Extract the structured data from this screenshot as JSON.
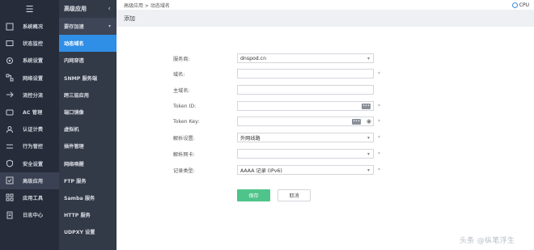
{
  "sidebar": {
    "menu_icon": "☰",
    "items": [
      {
        "label": "系统概况",
        "icon": "dashboard-icon"
      },
      {
        "label": "状态监控",
        "icon": "monitor-icon"
      },
      {
        "label": "系统设置",
        "icon": "gear-icon"
      },
      {
        "label": "网络设置",
        "icon": "network-icon"
      },
      {
        "label": "流控分流",
        "icon": "flow-icon"
      },
      {
        "label": "AC 管理",
        "icon": "ac-icon"
      },
      {
        "label": "认证计费",
        "icon": "auth-icon"
      },
      {
        "label": "行为管控",
        "icon": "behavior-icon"
      },
      {
        "label": "安全设置",
        "icon": "security-icon"
      },
      {
        "label": "高级应用",
        "icon": "advanced-icon"
      },
      {
        "label": "应用工具",
        "icon": "tools-icon"
      },
      {
        "label": "日志中心",
        "icon": "log-icon"
      }
    ]
  },
  "subnav": {
    "title": "高级应用",
    "collapse": "‹",
    "group_label": "要存加速",
    "group_caret": "▾",
    "items": [
      {
        "label": "动态域名"
      },
      {
        "label": "内网穿透"
      },
      {
        "label": "SNMP 服务端"
      },
      {
        "label": "跨三层应用"
      },
      {
        "label": "端口镜像"
      },
      {
        "label": "虚拟机"
      },
      {
        "label": "插件管理"
      },
      {
        "label": "网络唤醒"
      },
      {
        "label": "FTP 服务"
      },
      {
        "label": "Samba 服务"
      },
      {
        "label": "HTTP 服务"
      },
      {
        "label": "UDPXY 设置"
      }
    ]
  },
  "breadcrumb": "高级应用 > 动态域名",
  "cpu_label": "CPU",
  "page_title": "添加",
  "form": {
    "provider": {
      "label": "服务商:",
      "value": "dnspod.cn"
    },
    "domain": {
      "label": "域名:",
      "value": "",
      "req": "*"
    },
    "host": {
      "label": "主域名:",
      "value": ""
    },
    "token_id": {
      "label": "Token ID:",
      "value": "",
      "req": "*"
    },
    "token_key": {
      "label": "Token Key:",
      "value": "",
      "req": "*"
    },
    "resolve": {
      "label": "解析设置:",
      "value": "外网线路",
      "req": "*"
    },
    "iface": {
      "label": "解析网卡:",
      "value": "",
      "req": "*"
    },
    "record": {
      "label": "记录类型:",
      "value": "AAAA 记录 (IPv6)",
      "req": "*"
    },
    "dots": "•••",
    "eye": "◉"
  },
  "buttons": {
    "save": "保存",
    "cancel": "取消"
  },
  "watermark": "头条 @纵笔浮生"
}
